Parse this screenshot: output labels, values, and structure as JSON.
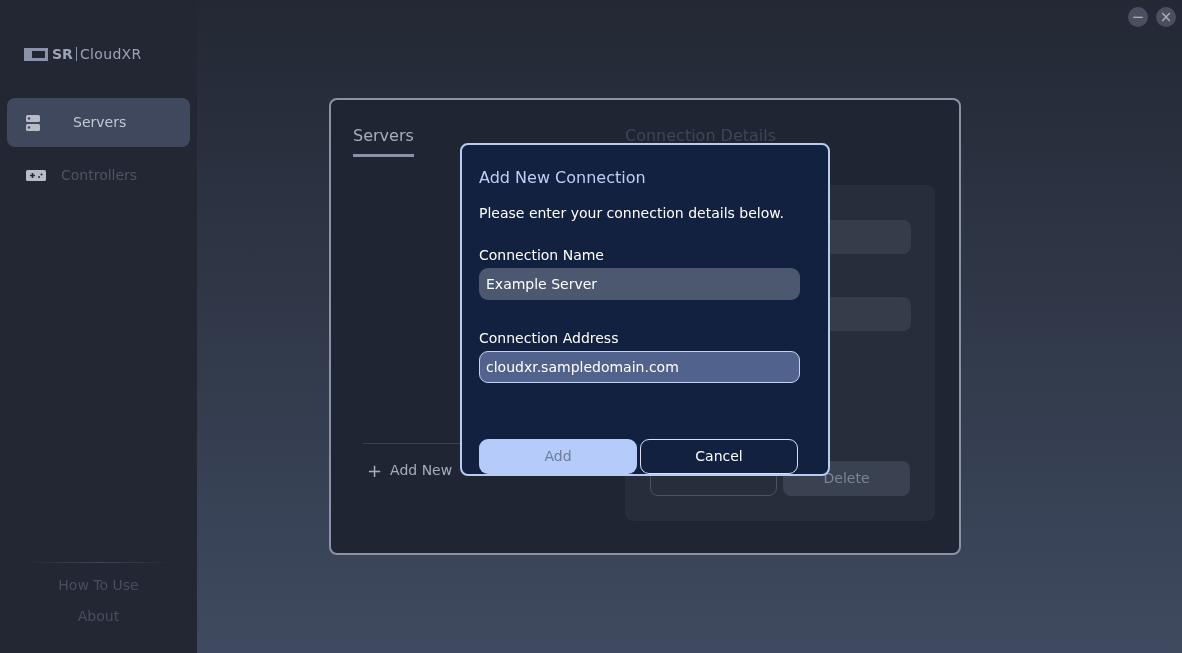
{
  "window_controls": {
    "minimize": "−",
    "close": "×"
  },
  "sidebar": {
    "logo_text": "SR",
    "logo_product": "CloudXR",
    "items": [
      {
        "label": "Servers",
        "selected": true
      },
      {
        "label": "Controllers",
        "selected": false
      }
    ],
    "footer_links": [
      "How To Use",
      "About"
    ]
  },
  "panel": {
    "tabs": [
      {
        "label": "Servers",
        "selected": true
      },
      {
        "label": "Connection Details",
        "selected": false
      }
    ],
    "add_link": {
      "icon": "+",
      "label": "Add New"
    },
    "details_buttons": [
      {
        "kind": "outline"
      },
      {
        "label": "Delete",
        "kind": "filled"
      }
    ]
  },
  "dialog": {
    "title": "Add New Connection",
    "message": "Please enter your connection details below.",
    "fields": [
      {
        "label": "Connection Name",
        "value": "Example Server",
        "focused": false
      },
      {
        "label": "Connection Address",
        "value": "cloudxr.sampledomain.com",
        "focused": true
      }
    ],
    "buttons": [
      {
        "label": "Add",
        "kind": "primary",
        "disabled": true
      },
      {
        "label": "Cancel",
        "kind": "outline",
        "disabled": false
      }
    ]
  }
}
